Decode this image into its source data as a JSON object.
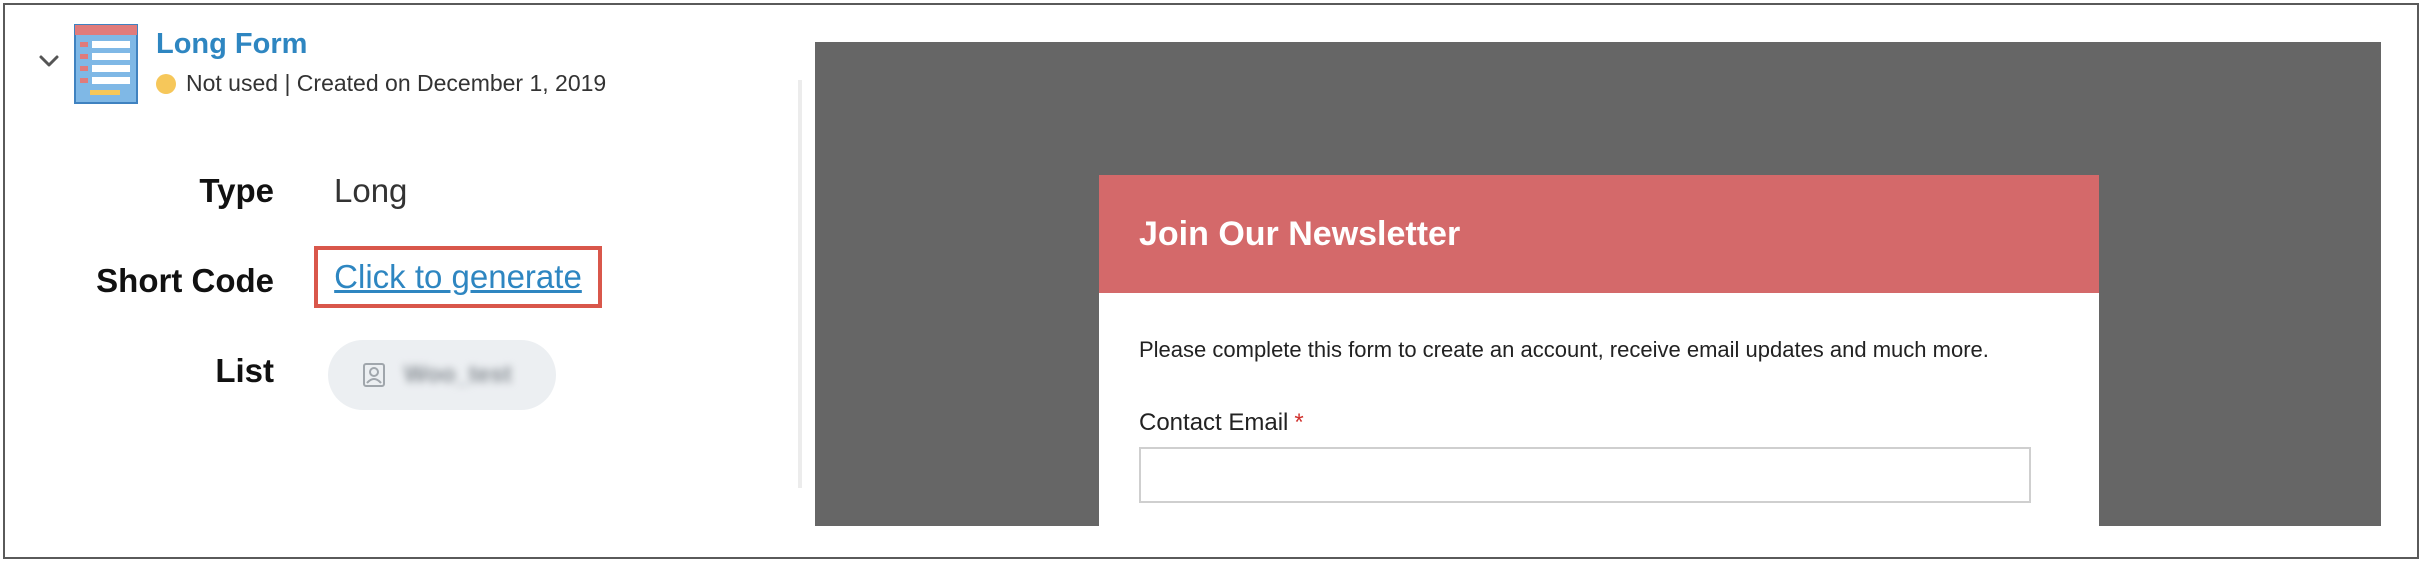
{
  "form": {
    "title": "Long Form",
    "status": "Not used | Created on December 1, 2019",
    "status_color": "#f6c75a",
    "title_color": "#2e86c1",
    "icon": "form-list-icon"
  },
  "details": {
    "type_label": "Type",
    "type_value": "Long",
    "shortcode_label": "Short Code",
    "shortcode_link": "Click to generate",
    "list_label": "List",
    "list_value": "Woo_test",
    "list_icon": "contact-card-icon"
  },
  "preview": {
    "background": "#666666",
    "header_color": "#d4696a",
    "heading": "Join Our Newsletter",
    "description": "Please complete this form to create an account, receive email updates and much more.",
    "email_label": "Contact Email",
    "required_marker": "*"
  }
}
